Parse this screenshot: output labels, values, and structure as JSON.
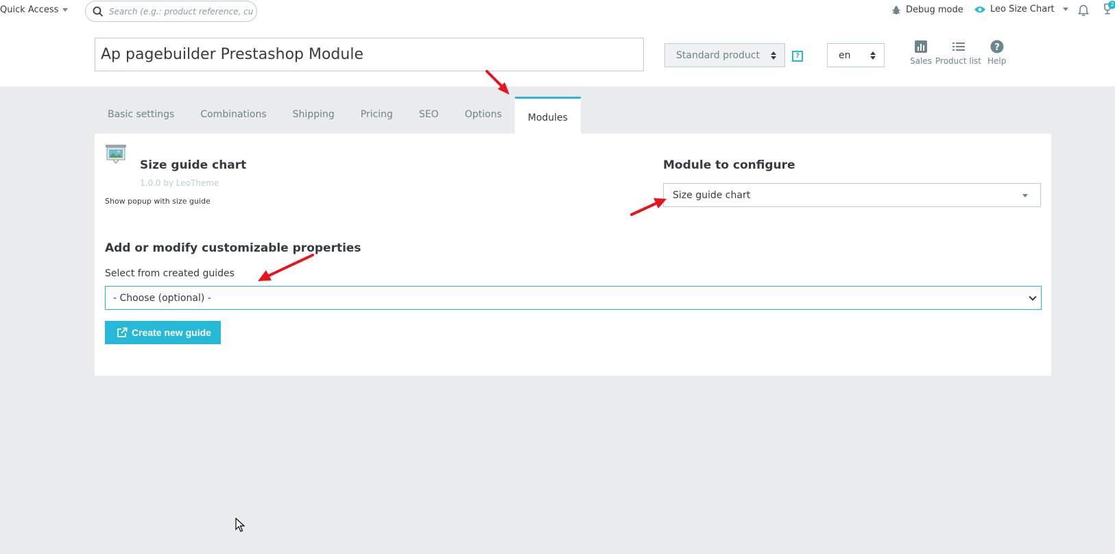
{
  "topbar": {
    "quick_access": "Quick Access",
    "search_placeholder": "Search (e.g.: product reference, customer name...)",
    "debug_mode": "Debug mode",
    "shop_name": "Leo Size Chart",
    "badge_count": "2"
  },
  "product": {
    "name": "Ap pagebuilder Prestashop Module",
    "type": "Standard product",
    "help": "?",
    "language": "en",
    "tools": [
      {
        "label": "Sales"
      },
      {
        "label": "Product list"
      },
      {
        "label": "Help"
      }
    ]
  },
  "tabs": [
    {
      "label": "Basic settings"
    },
    {
      "label": "Combinations"
    },
    {
      "label": "Shipping"
    },
    {
      "label": "Pricing"
    },
    {
      "label": "SEO"
    },
    {
      "label": "Options"
    },
    {
      "label": "Modules",
      "active": true
    }
  ],
  "module": {
    "title": "Size guide chart",
    "version": "1.0.0 by LeoTheme",
    "description": "Show popup with size guide",
    "configure_title": "Module to configure",
    "configure_value": "Size guide chart"
  },
  "properties": {
    "title": "Add or modify customizable properties",
    "select_label": "Select from created guides",
    "select_value": "- Choose (optional) -",
    "create_button": "Create new guide"
  },
  "colors": {
    "accent": "#25b9d7",
    "annotation": "#e8141b",
    "background": "#eaebec"
  }
}
